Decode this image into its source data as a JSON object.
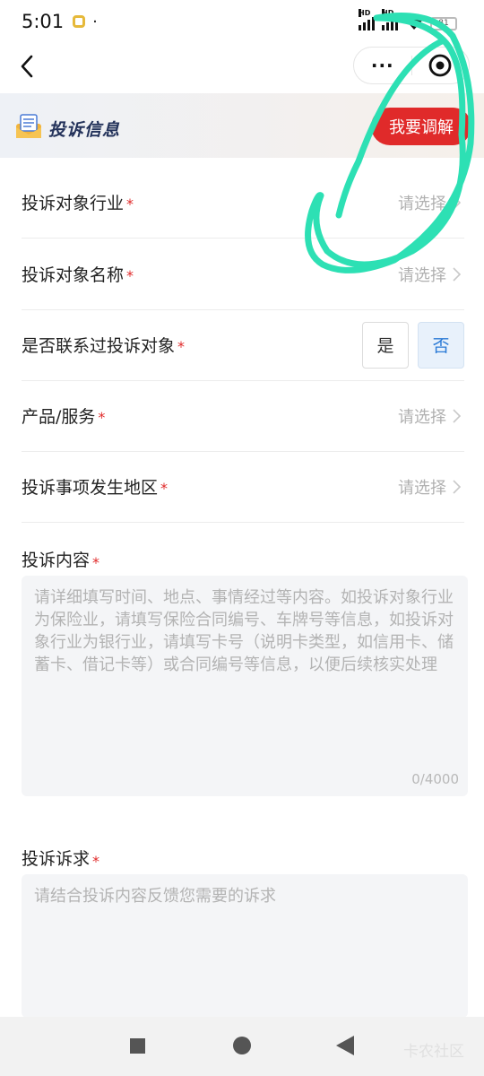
{
  "status_bar": {
    "time": "5:01",
    "extra_dot": "·",
    "battery": "81",
    "signal1_label": "HD",
    "signal2_label": "HD"
  },
  "nav": {
    "more_label": "···"
  },
  "section": {
    "title": "投诉信息",
    "mediate_button": "我要调解"
  },
  "form": {
    "required_mark": "*",
    "rows": [
      {
        "label": "投诉对象行业",
        "value": "请选择"
      },
      {
        "label": "投诉对象名称",
        "value": "请选择"
      },
      {
        "label": "是否联系过投诉对象",
        "value": ""
      },
      {
        "label": "产品/服务",
        "value": "请选择"
      },
      {
        "label": "投诉事项发生地区",
        "value": "请选择"
      }
    ],
    "contact_options": {
      "yes": "是",
      "no": "否",
      "selected": "否"
    },
    "content": {
      "label": "投诉内容",
      "placeholder": "请详细填写时间、地点、事情经过等内容。如投诉对象行业为保险业，请填写保险合同编号、车牌号等信息，如投诉对象行业为银行业，请填写卡号（说明卡类型，如信用卡、储蓄卡、借记卡等）或合同编号等信息，以便后续核实处理",
      "counter": "0/4000"
    },
    "demand": {
      "label": "投诉诉求",
      "placeholder": "请结合投诉内容反馈您需要的诉求"
    }
  },
  "system_nav": {
    "watermark": "卡农社区"
  },
  "colors": {
    "accent_red": "#e02a2a",
    "selected_blue": "#2a7ad6",
    "annotation_stroke": "#2de0b4"
  }
}
